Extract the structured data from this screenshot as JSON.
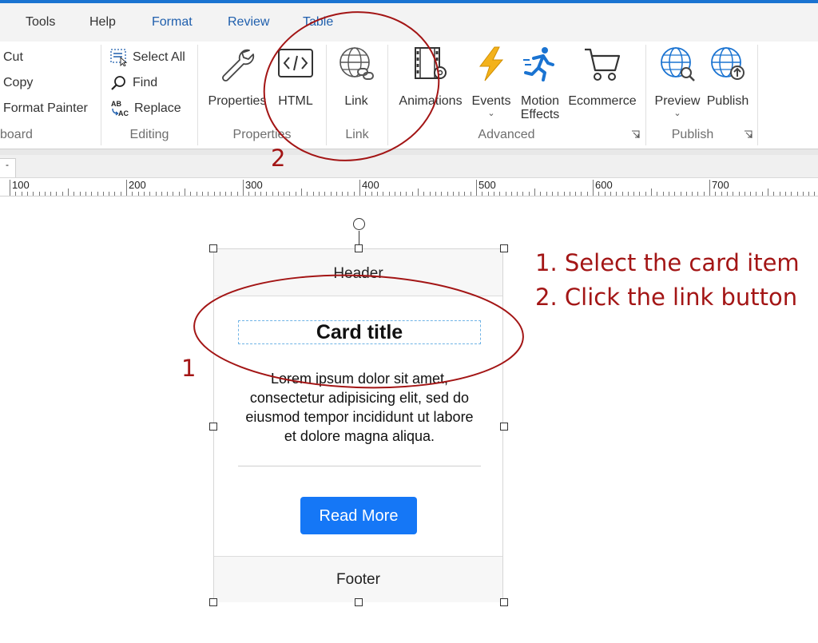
{
  "tabs": [
    "Tools",
    "Help",
    "Format",
    "Review",
    "Table"
  ],
  "clipboard": {
    "cut": "Cut",
    "copy": "Copy",
    "format_painter": "Format Painter",
    "group_label": "board"
  },
  "editing": {
    "select_all": "Select All",
    "find": "Find",
    "replace": "Replace",
    "group_label": "Editing"
  },
  "properties": {
    "properties": "Properties",
    "html": "HTML",
    "group_label": "Properties"
  },
  "link": {
    "link": "Link",
    "group_label": "Link"
  },
  "advanced": {
    "animations": "Animations",
    "events": "Events",
    "motion1": "Motion",
    "motion2": "Effects",
    "ecommerce": "Ecommerce",
    "group_label": "Advanced"
  },
  "publish": {
    "preview": "Preview",
    "publish": "Publish",
    "group_label": "Publish"
  },
  "ruler": {
    "labels": [
      "100",
      "200",
      "300",
      "400",
      "500",
      "600",
      "700"
    ]
  },
  "card": {
    "header": "Header",
    "title": "Card title",
    "text": "Lorem ipsum dolor sit amet, consectetur adipisicing elit, sed do eiusmod tempor incididunt ut labore et dolore magna aliqua.",
    "button": "Read More",
    "footer": "Footer"
  },
  "annotations": {
    "marker1": "1",
    "marker2": "2",
    "step1": "1. Select the card item",
    "step2": "2. Click the link button",
    "color": "#a31515"
  },
  "colors": {
    "accent": "#1a73d1",
    "button": "#1577f6",
    "selection": "#6fb3e6"
  }
}
